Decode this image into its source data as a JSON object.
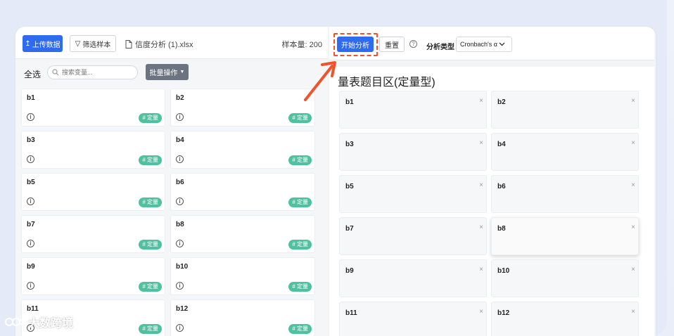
{
  "toolbar": {
    "upload_label": "上传数据",
    "filter_label": "筛选样本",
    "file_name": "信度分析 (1).xlsx",
    "sample_count": "样本量: 200"
  },
  "subbar": {
    "select_all": "全选",
    "search_placeholder": "搜索变量...",
    "batch_label": "批量操作"
  },
  "variables": [
    {
      "name": "b1",
      "tag": "# 定量"
    },
    {
      "name": "b2",
      "tag": "# 定量"
    },
    {
      "name": "b3",
      "tag": "# 定量"
    },
    {
      "name": "b4",
      "tag": "# 定量"
    },
    {
      "name": "b5",
      "tag": "# 定量"
    },
    {
      "name": "b6",
      "tag": "# 定量"
    },
    {
      "name": "b7",
      "tag": "# 定量"
    },
    {
      "name": "b8",
      "tag": "# 定量"
    },
    {
      "name": "b9",
      "tag": "# 定量"
    },
    {
      "name": "b10",
      "tag": "# 定量"
    },
    {
      "name": "b11",
      "tag": "# 定量"
    },
    {
      "name": "b12",
      "tag": "# 定量"
    }
  ],
  "analysis": {
    "start_label": "开始分析",
    "reset_label": "重置",
    "type_label": "分析类型",
    "type_value": "Cronbach's α"
  },
  "scale_area": {
    "title": "量表题目区(定量型)",
    "items": [
      "b1",
      "b2",
      "b3",
      "b4",
      "b5",
      "b6",
      "b7",
      "b8",
      "b9",
      "b10",
      "b11",
      "b12"
    ],
    "close_symbol": "×"
  },
  "watermark": "大数跨境",
  "colors": {
    "primary": "#2f6bef",
    "tag_green": "#4cc39e",
    "highlight_red": "#f0532b"
  }
}
